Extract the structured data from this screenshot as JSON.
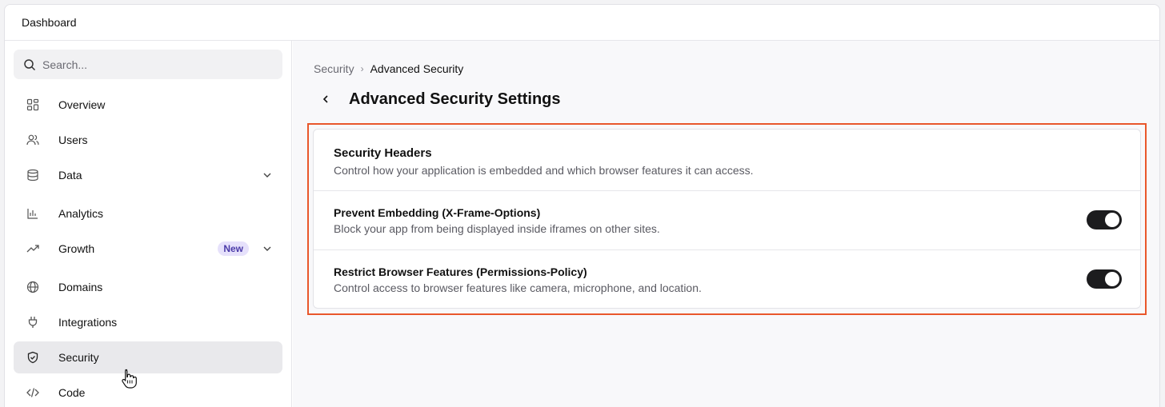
{
  "window": {
    "title": "Dashboard"
  },
  "sidebar": {
    "search_placeholder": "Search...",
    "items": [
      {
        "label": "Overview",
        "icon": "grid-icon"
      },
      {
        "label": "Users",
        "icon": "users-icon"
      },
      {
        "label": "Data",
        "icon": "database-icon",
        "expandable": true
      },
      {
        "label": "Analytics",
        "icon": "bar-chart-icon"
      },
      {
        "label": "Growth",
        "icon": "trending-up-icon",
        "badge": "New",
        "expandable": true
      },
      {
        "label": "Domains",
        "icon": "globe-icon"
      },
      {
        "label": "Integrations",
        "icon": "plug-icon"
      },
      {
        "label": "Security",
        "icon": "shield-icon",
        "active": true
      },
      {
        "label": "Code",
        "icon": "code-icon"
      }
    ]
  },
  "breadcrumb": {
    "parent": "Security",
    "current": "Advanced Security"
  },
  "page": {
    "title": "Advanced Security Settings"
  },
  "card": {
    "title": "Security Headers",
    "description": "Control how your application is embedded and which browser features it can access.",
    "settings": [
      {
        "title": "Prevent Embedding (X-Frame-Options)",
        "description": "Block your app from being displayed inside iframes on other sites.",
        "enabled": true
      },
      {
        "title": "Restrict Browser Features (Permissions-Policy)",
        "description": "Control access to browser features like camera, microphone, and location.",
        "enabled": true
      }
    ]
  },
  "colors": {
    "highlight": "#e9572b",
    "toggle_on": "#1c1c1e",
    "badge_bg": "#e6e1fb",
    "badge_text": "#4a3aa8"
  }
}
